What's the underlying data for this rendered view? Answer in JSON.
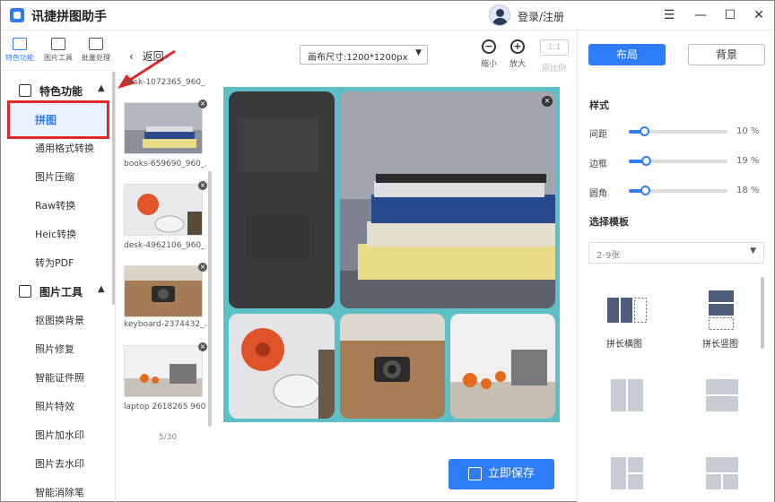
{
  "titlebar": {
    "app_title": "讯捷拼图助手",
    "login_label": "登录/注册",
    "minimize": "☰",
    "min": "—",
    "max": "☐",
    "close": "✕"
  },
  "tools": [
    {
      "label": "特色功能"
    },
    {
      "label": "图片工具"
    },
    {
      "label": "批量处理"
    }
  ],
  "sidebar": {
    "section1": {
      "label": "特色功能"
    },
    "active_item": "拼图",
    "section1_items": [
      "通用格式转换",
      "图片压缩",
      "Raw转换",
      "Heic转换",
      "转为PDF"
    ],
    "section2": {
      "label": "图片工具"
    },
    "section2_items": [
      "抠图换背景",
      "照片修复",
      "智能证件照",
      "照片特效",
      "图片加水印",
      "图片去水印",
      "智能消除笔"
    ]
  },
  "thumbs": {
    "back_label": "返回",
    "items": [
      {
        "name": "desk-1072365_960_..."
      },
      {
        "name": "books-659690_960_..."
      },
      {
        "name": "desk-4962106_960_..."
      },
      {
        "name": "keyboard-2374432_..."
      },
      {
        "name": "laptop 2618265 960..."
      }
    ],
    "page_count": "5/30"
  },
  "toolbar": {
    "canvas_size": "画布尺寸:1200*1200px",
    "zoom_out": "缩小",
    "zoom_in": "放大",
    "ratio": "1:1",
    "ratio_label": "原比例"
  },
  "save_label": "立即保存",
  "rpanel": {
    "tab_layout": "布局",
    "tab_background": "背景",
    "style_heading": "样式",
    "sliders": [
      {
        "label": "间距",
        "value": "10 %",
        "level": 0.1
      },
      {
        "label": "边框",
        "value": "19 %",
        "level": 0.19
      },
      {
        "label": "圆角",
        "value": "18 %",
        "level": 0.18
      }
    ],
    "template_heading": "选择模板",
    "count_select": "2-9张",
    "layouts": [
      {
        "label": "拼长横图"
      },
      {
        "label": "拼长竖图"
      }
    ]
  },
  "colors": {
    "accent": "#2e7cf6",
    "highlight": "#e02a2a",
    "canvas_bg": "#5dc0c6"
  }
}
